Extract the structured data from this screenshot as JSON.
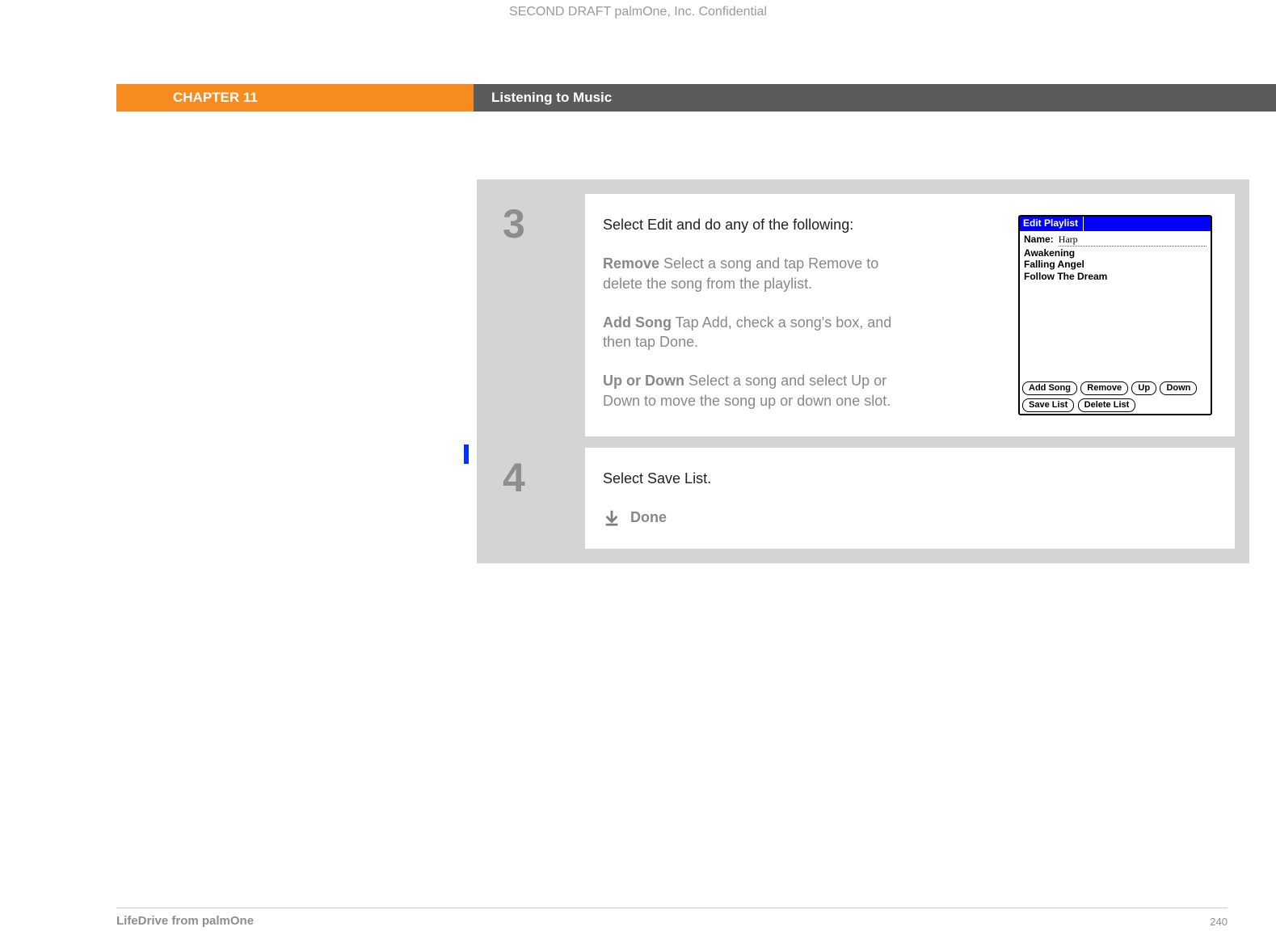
{
  "header": {
    "draft": "SECOND DRAFT palmOne, Inc.  Confidential",
    "chapter": "CHAPTER 11",
    "chapter_title": "Listening to Music"
  },
  "steps": {
    "s3": {
      "num": "3",
      "intro": "Select Edit and do any of the following:",
      "opts": [
        {
          "title": "Remove",
          "body": "   Select a song and tap Remove to delete the song from the playlist."
        },
        {
          "title": "Add Song",
          "body": "    Tap Add, check a song's box, and then tap Done."
        },
        {
          "title": "Up or Down",
          "body": "   Select a song and select Up or Down to move the song up or down one slot."
        }
      ],
      "screenshot": {
        "title": "Edit Playlist",
        "name_label": "Name:",
        "name_value": "Harp",
        "songs": [
          "Awakening",
          "Falling Angel",
          "Follow The Dream"
        ],
        "buttons_row1": [
          "Add Song",
          "Remove",
          "Up",
          "Down"
        ],
        "buttons_row2": [
          "Save List",
          "Delete List"
        ]
      }
    },
    "s4": {
      "num": "4",
      "text": "Select Save List.",
      "done": "Done"
    }
  },
  "footer": {
    "left": "LifeDrive from palmOne",
    "right": "240"
  }
}
